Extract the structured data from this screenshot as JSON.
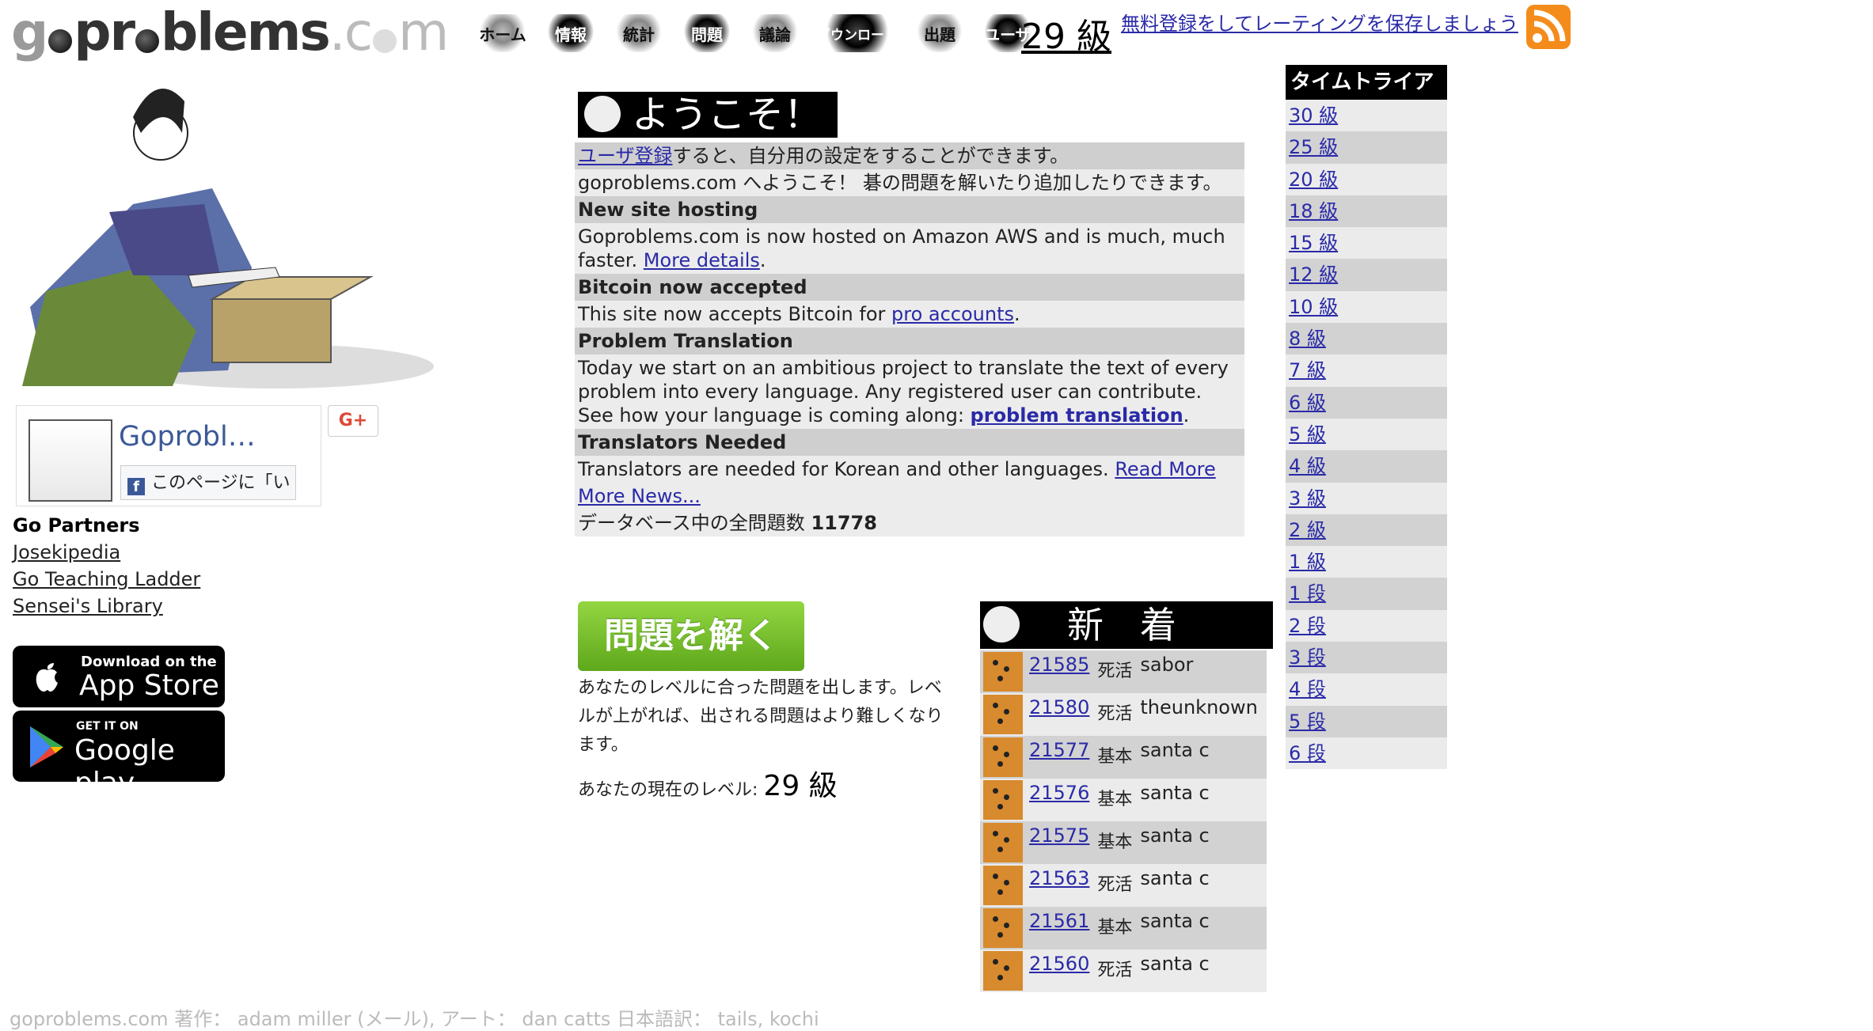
{
  "header": {
    "logo": "goproblems.com",
    "nav": [
      "ホーム",
      "情報",
      "統計",
      "問題",
      "議論",
      "ダウンロード",
      "出題",
      "ユーザ"
    ],
    "rank": "29 級",
    "signup": "無料登録をしてレーティングを保存しましょう",
    "rss_icon": "rss-icon"
  },
  "facebook": {
    "page_title": "Goprobl…",
    "like_label": "このページに「い"
  },
  "gplus_label": "G+",
  "partners": {
    "title": "Go Partners",
    "links": [
      "Josekipedia",
      "Go Teaching Ladder",
      "Sensei's Library"
    ]
  },
  "stores": {
    "appstore_small": "Download on the",
    "appstore_big": "App Store",
    "gplay_small": "GET IT ON",
    "gplay_big": "Google play"
  },
  "welcome": {
    "title": "ようこそ！",
    "register_link": "ユーザ登録",
    "register_text": "すると、自分用の設定をすることができます。",
    "intro": "goproblems.com へようこそ！ 碁の問題を解いたり追加したりできます。",
    "news": [
      {
        "head": "New site hosting",
        "body": "Goproblems.com is now hosted on Amazon AWS and is much, much faster.",
        "link": "More details"
      },
      {
        "head": "Bitcoin now accepted",
        "body": "This site now accepts Bitcoin for",
        "link": "pro accounts"
      },
      {
        "head": "Problem Translation",
        "body": "Today we start on an ambitious project to translate the text of every problem into every language. Any registered user can contribute. See how your language is coming along:",
        "link": "problem translation"
      },
      {
        "head": "Translators Needed",
        "body": "Translators are needed for Korean and other languages.",
        "link": "Read More"
      }
    ],
    "more_news": "More News...",
    "db_count_label": "データベース中の全問題数",
    "db_count": "11778"
  },
  "solve": {
    "button": "問題を解く",
    "desc": "あなたのレベルに合った問題を出します。レベルが上がれば、出される問題はより難しくなります。",
    "level_label": "あなたの現在のレベル:",
    "level_value": "29 級"
  },
  "new_problems": {
    "title": "新　着",
    "items": [
      {
        "id": "21585",
        "type": "死活",
        "user": "sabor"
      },
      {
        "id": "21580",
        "type": "死活",
        "user": "theunknown"
      },
      {
        "id": "21577",
        "type": "基本",
        "user": "santa c"
      },
      {
        "id": "21576",
        "type": "基本",
        "user": "santa c"
      },
      {
        "id": "21575",
        "type": "基本",
        "user": "santa c"
      },
      {
        "id": "21563",
        "type": "死活",
        "user": "santa c"
      },
      {
        "id": "21561",
        "type": "基本",
        "user": "santa c"
      },
      {
        "id": "21560",
        "type": "死活",
        "user": "santa c"
      }
    ]
  },
  "time_trial": {
    "title": "タイムトライアル",
    "levels": [
      "30 級",
      "25 級",
      "20 級",
      "18 級",
      "15 級",
      "12 級",
      "10 級",
      "8 級",
      "7 級",
      "6 級",
      "5 級",
      "4 級",
      "3 級",
      "2 級",
      "1 級",
      "1 段",
      "2 段",
      "3 段",
      "4 段",
      "5 段",
      "6 段"
    ]
  },
  "footer": "goproblems.com 著作： adam miller (メール), アート： dan catts 日本語訳： tails, kochi"
}
